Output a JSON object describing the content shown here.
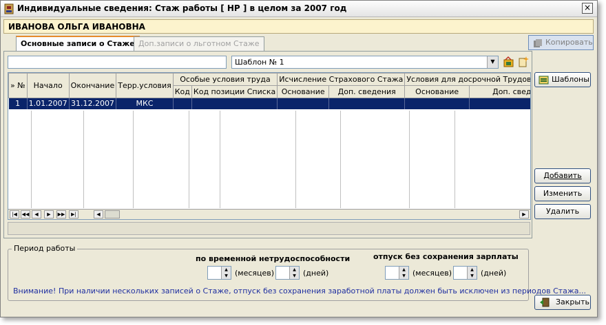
{
  "window": {
    "title": "Индивидуальные сведения: Стаж работы [ НР ] в целом за 2007 год",
    "close_label": "×",
    "person_name": "ИВАНОВА ОЛЬГА ИВАНОВНА"
  },
  "tabs": [
    {
      "label": "Основные записи о Стаже",
      "active": true
    },
    {
      "label": "Доп.записи о льготном Стаже",
      "active": false
    }
  ],
  "toolbar": {
    "copy_label": "Копировать",
    "template_value": "Шаблон № 1",
    "filter_value": ""
  },
  "grid": {
    "col_headers": [
      "» №",
      "Начало",
      "Окончание",
      "Терр.условия"
    ],
    "group_headers": [
      "Особые условия труда",
      "Исчисление Страхового Стажа",
      "Условия для досрочной Трудовой пенсии"
    ],
    "sub_headers": [
      "Код",
      "Код позиции Списка",
      "Основание",
      "Доп. сведения",
      "Основание",
      "Доп. сведения"
    ],
    "rows": [
      {
        "num": "1",
        "start": "1.01.2007",
        "end": "31.12.2007",
        "terr": "МКС",
        "c1": "",
        "c2": "",
        "c3": "",
        "c4": "",
        "c5": "",
        "c6": ""
      }
    ]
  },
  "side_buttons": {
    "templates": "Шаблоны",
    "add": "Добавить",
    "edit": "Изменить",
    "delete": "Удалить",
    "close": "Закрыть"
  },
  "period": {
    "legend": "Период работы",
    "sick_label": "по временной нетрудоспособности",
    "unpaid_label": "отпуск без сохранения зарплаты",
    "months_unit": "(месяцев)",
    "days_unit": "(дней)",
    "sick_months": "",
    "sick_days": "",
    "unpaid_months": "",
    "unpaid_days": "",
    "warning": "Внимание!  При наличии нескольких записей о Стаже, отпуск без сохранения заработной платы должен быть исключен из периодов Стажа..."
  }
}
